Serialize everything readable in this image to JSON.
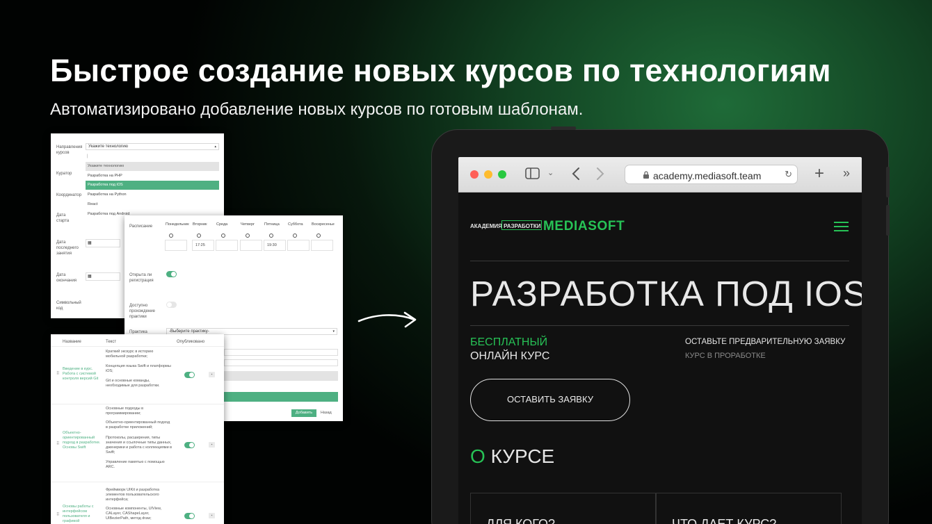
{
  "hero": {
    "title": "Быстрое создание новых курсов по технологиям",
    "subtitle": "Автоматизировано добавление новых курсов по готовым шаблонам."
  },
  "admin_form": {
    "labels": [
      "Направления курсов",
      "Куратор",
      "Координатор",
      "Дата старта",
      "Дата последнего занятия",
      "Дата окончания",
      "Символьный код"
    ],
    "direction_value": "Укажите технологию",
    "direction_options": [
      "Укажите технологию",
      "Разработка на PHP",
      "Разработка под iOS",
      "Разработка на Python",
      "React",
      "Разработка под Android"
    ],
    "selected_option": "Разработка под iOS"
  },
  "schedule_form": {
    "schedule_label": "Расписание",
    "days": [
      "Понедельник",
      "Вторник",
      "Среда",
      "Четверг",
      "Пятница",
      "Суббота",
      "Воскресенье"
    ],
    "times": [
      "",
      "17:25",
      "",
      "",
      "19:30",
      "",
      ""
    ],
    "registration_label": "Открыта ли регистрация",
    "practice_available_label": "Доступно прохождение практики",
    "practice_label": "Практика",
    "practice_placeholder": "-Выберите практику-",
    "add_button": "Добавить",
    "back_button": "Назад"
  },
  "lessons_table": {
    "headers": [
      "Название",
      "Текст",
      "Опубликовано"
    ],
    "rows": [
      {
        "name": "Введение в курс. Работа с системой контроля версий Git",
        "text": [
          "Краткий экскурс в историю мобильной разработки;",
          "Концепция языка Swift и платформы iOS;",
          "Git и основные команды, необходимые для разработки."
        ],
        "published": true
      },
      {
        "name": "Объектно-ориентированный подход в разработке. Основы Swift",
        "text": [
          "Основные подходы в программировании;",
          "Объектно-ориентированный подход в разработке приложений;",
          "Протоколы, расширения, типы значения и ссылочные типы данных, дженерики и работа с коллекциями в Swift;",
          "Управление памятью с помощью ARC."
        ],
        "published": true
      },
      {
        "name": "Основы работы с интерфейсом пользователя и графикой",
        "text": [
          "Фреймворк UIKit и разработка элементов пользовательского интерфейса;",
          "Основные компоненты, UIView, CALayer, CAShapeLayer, UIBezierPath, метод draw;"
        ],
        "published": true
      }
    ]
  },
  "browser": {
    "url": "academy.mediasoft.team",
    "traffic_colors": [
      "#ff5f57",
      "#febc2e",
      "#28c840"
    ]
  },
  "site": {
    "logo_small": "АКАДЕМИЯ РАЗРАБОТКИ",
    "logo_big": "MEDIASOFT",
    "page_title": "РАЗРАБОТКА ПОД IOS",
    "price_label": "БЕСПЛАТНЫЙ",
    "format_label": "ОНЛАЙН КУРС",
    "pre_request": "ОСТАВЬТЕ ПРЕДВАРИТЕЛЬНУЮ ЗАЯВКУ",
    "status": "КУРС В ПРОРАБОТКЕ",
    "cta_button": "ОСТАВИТЬ ЗАЯВКУ",
    "about_prefix": "О",
    "about_rest": "КУРСЕ",
    "card_1": "ДЛЯ КОГО?",
    "card_2": "ЧТО ДАЕТ КУРС?",
    "accent_color": "#27c256"
  }
}
